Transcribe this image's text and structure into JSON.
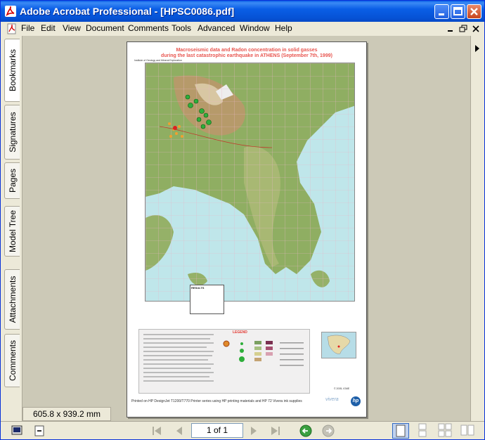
{
  "window": {
    "title": "Adobe Acrobat Professional - [HPSC0086.pdf]",
    "colors": {
      "titlebar": "#0a5ee6",
      "close": "#c8451e",
      "workspace": "#ccc9b7"
    }
  },
  "menu": {
    "items": [
      "File",
      "Edit",
      "View",
      "Document",
      "Comments",
      "Tools",
      "Advanced",
      "Window",
      "Help"
    ]
  },
  "nav_tabs": [
    "Bookmarks",
    "Signatures",
    "Pages",
    "Model Tree",
    "Attachments",
    "Comments"
  ],
  "document": {
    "poster_title_line1": "Macroseismic data and Radon concentration in solid gasses",
    "poster_title_line2": "during the last catastrophic earthquake in ATHENS (September 7th, 1999)",
    "institute": "Institute of Geology and Mineral Exploration",
    "results_heading": "RESULTS",
    "legend_title": "LEGEND",
    "footer": "Printed on HP DesignJet T1200/T770 Printer series using HP printing materials and HP 72 Vivera ink supplies",
    "brand": "vivera",
    "hp": "hp",
    "copyright": "© 2005, IGME"
  },
  "page_size": "605.8 x 939.2 mm",
  "pagination": {
    "current": "1 of 1"
  }
}
